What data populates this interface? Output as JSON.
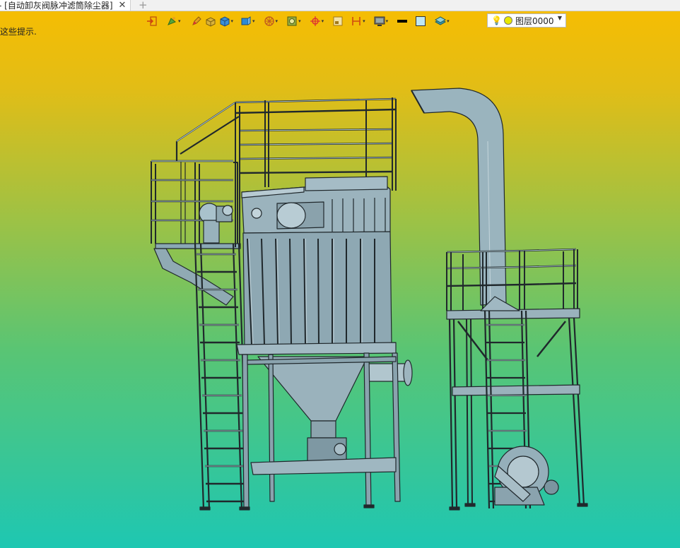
{
  "tab": {
    "title": "- [自动卸灰阀脉冲滤筒除尘器]",
    "close_glyph": "✕",
    "add_glyph": "+"
  },
  "toolbar": {
    "icons": [
      "exit-icon",
      "paint-icon",
      "pencil-icon",
      "solid-box-icon",
      "cube-icon",
      "cube-view-icon",
      "wheel-icon",
      "render-icon",
      "snap-icon",
      "frame-icon",
      "dimension-icon",
      "monitor-icon",
      "black-line-icon",
      "color-square-icon",
      "layers-icon"
    ]
  },
  "layer_selector": {
    "value": "图层0000",
    "bulb": "💡"
  },
  "hint_text": "这些提示."
}
